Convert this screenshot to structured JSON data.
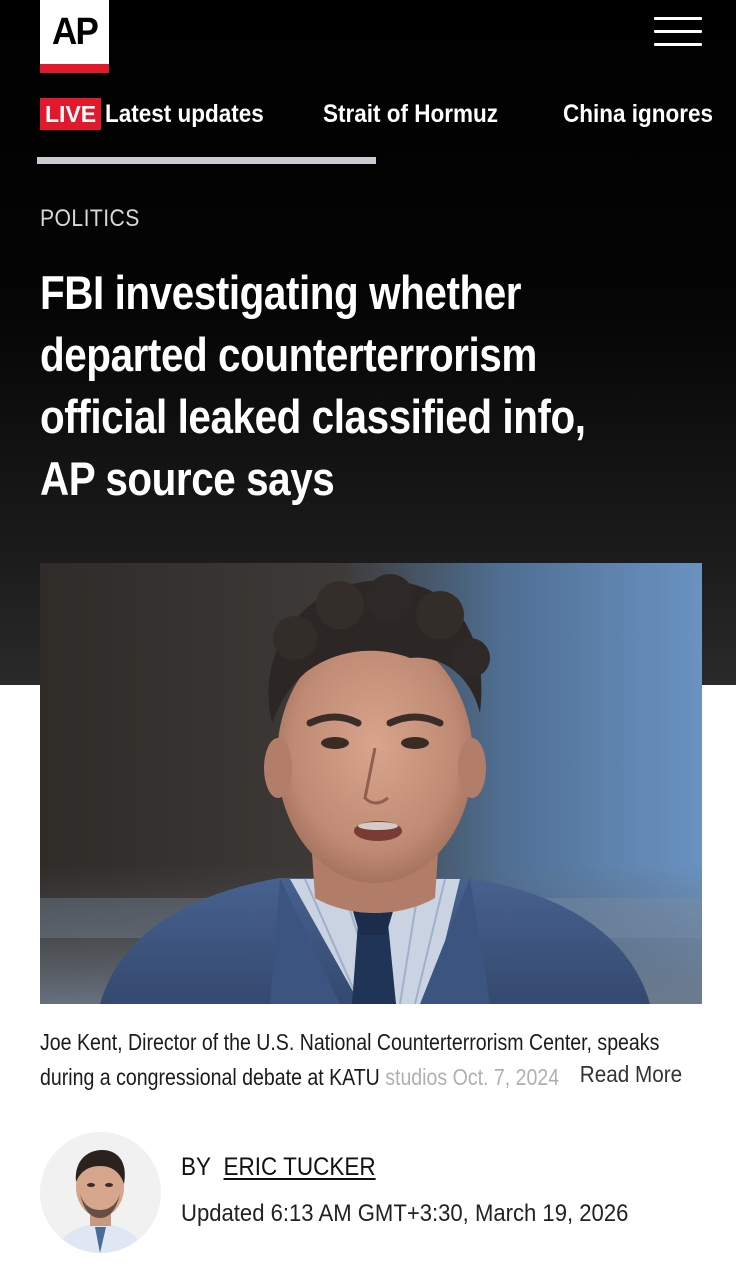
{
  "header": {
    "logo_text": "AP",
    "logo_bar_color": "#e2192d",
    "menu_icon": "hamburger-menu-icon"
  },
  "nav": {
    "live_badge": "LIVE",
    "items": [
      {
        "label": "Latest updates"
      },
      {
        "label": "Strait of Hormuz"
      },
      {
        "label": "China ignores"
      }
    ]
  },
  "article": {
    "section": "POLITICS",
    "headline_lines": [
      "FBI investigating whether",
      "departed counterterrorism",
      "official leaked classified info,",
      "AP source says"
    ],
    "caption": {
      "line1": "Joe Kent, Director of the U.S. National Counterterrorism Center, speaks",
      "line2_main": "during a congressional debate at KATU ",
      "line2_fade": "studios Oct. 7, 2024",
      "read_more": "Read More"
    },
    "byline": {
      "prefix": "BY",
      "author": "ERIC TUCKER"
    },
    "updated": "Updated 6:13 AM GMT+3:30, March 19, 2026"
  },
  "colors": {
    "accent_red": "#e2192d",
    "hero_background": "#000000",
    "nav_underline": "#c9ccd3"
  }
}
